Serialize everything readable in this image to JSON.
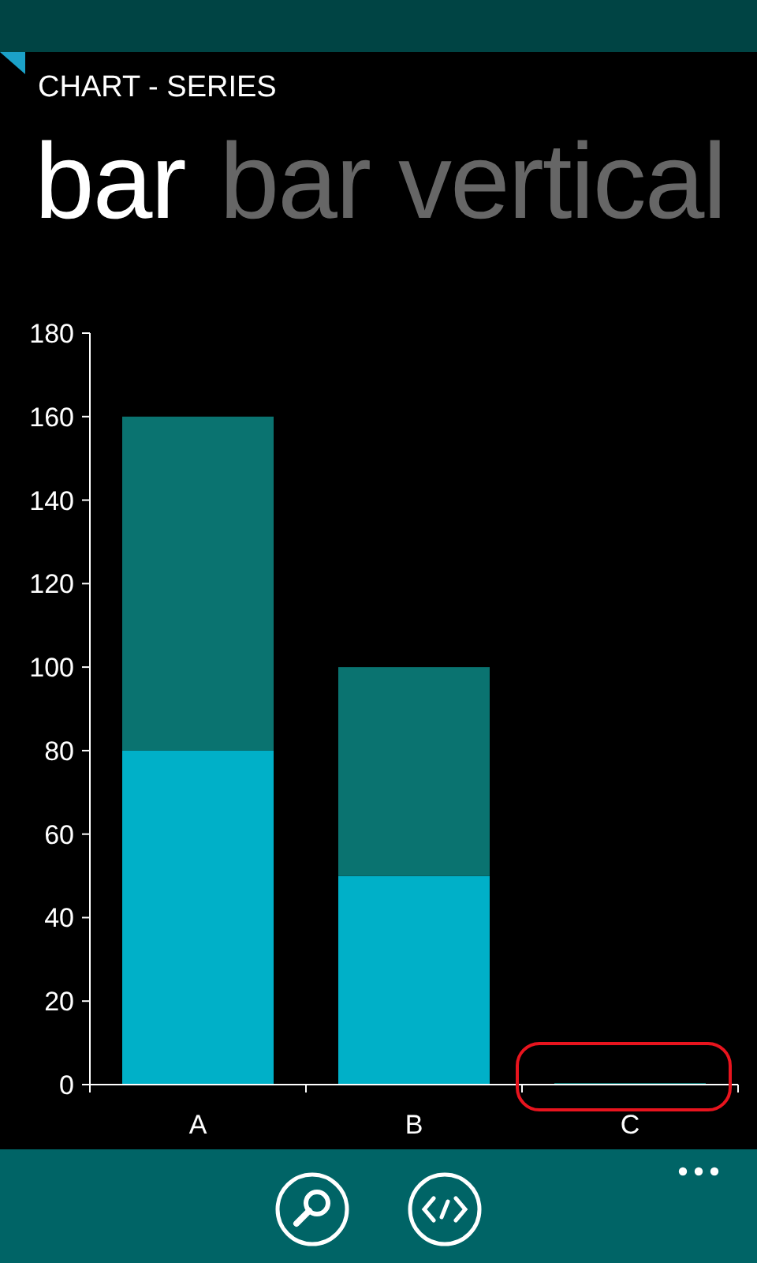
{
  "app_title": "CHART - SERIES",
  "pivot": [
    {
      "label": "bar",
      "selected": true
    },
    {
      "label": "bar vertical",
      "selected": false
    }
  ],
  "chart_data": {
    "type": "bar",
    "stacked": true,
    "orientation": "vertical",
    "categories": [
      "A",
      "B",
      "C"
    ],
    "series": [
      {
        "color": "#00b0c8",
        "values": [
          80,
          50,
          0
        ]
      },
      {
        "color": "#0a7370",
        "values": [
          80,
          50,
          0
        ]
      }
    ],
    "ylim": [
      0,
      180
    ],
    "yticks": [
      0,
      20,
      40,
      60,
      80,
      100,
      120,
      140,
      160,
      180
    ]
  },
  "app_bar": {
    "buttons": [
      {
        "kind": "search"
      },
      {
        "kind": "code"
      }
    ]
  }
}
